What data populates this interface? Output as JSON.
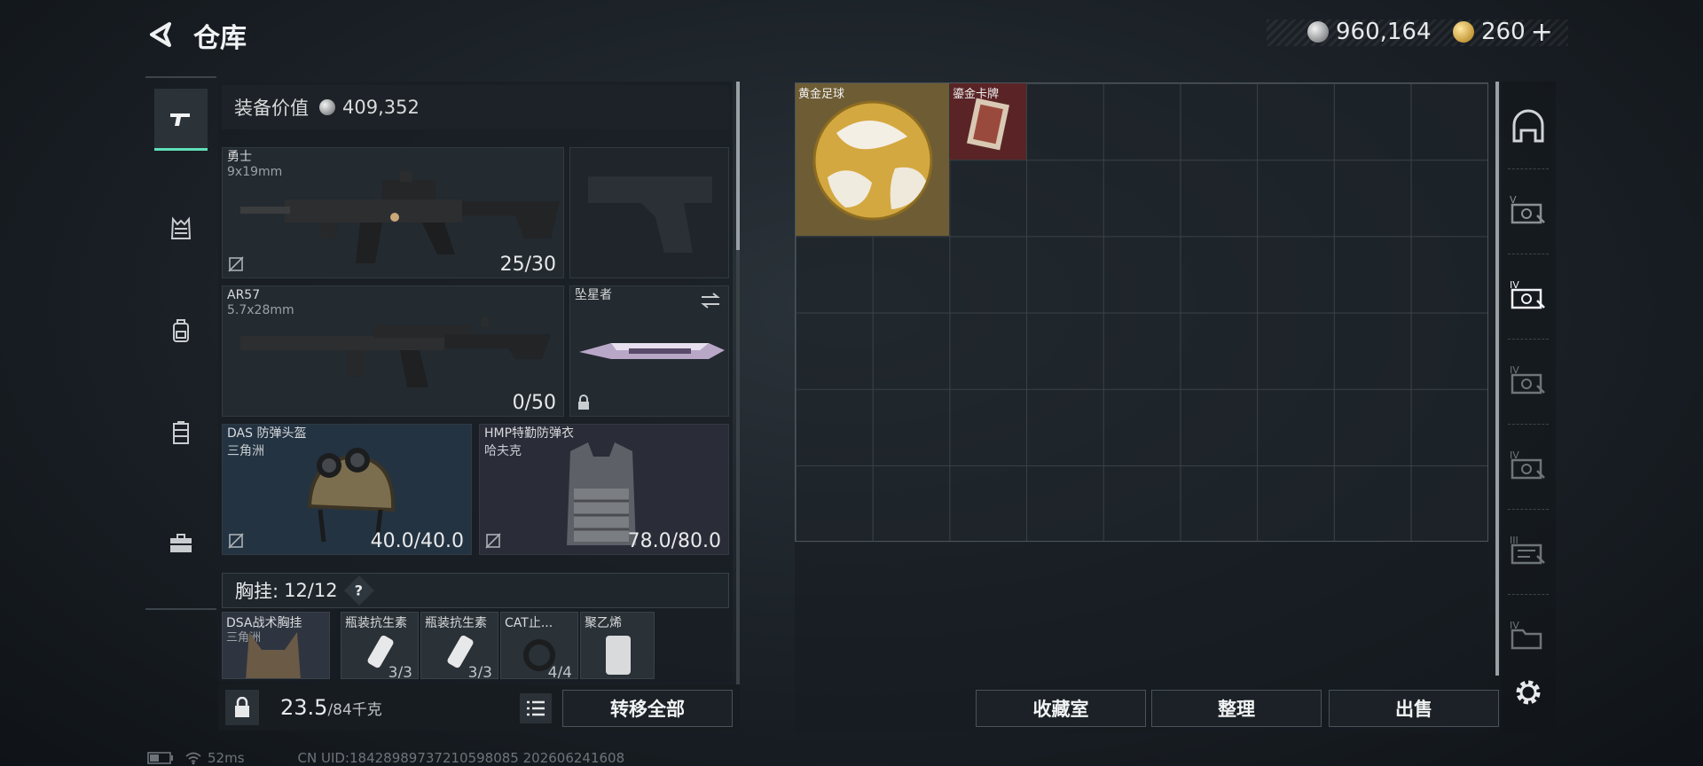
{
  "header": {
    "title": "仓库",
    "silver_amount": "960,164",
    "gold_amount": "260",
    "plus": "+"
  },
  "left_tabs": [
    "gun-icon",
    "chest-rig-icon",
    "backpack-icon",
    "container-icon",
    "briefcase-icon"
  ],
  "equipment": {
    "value_label": "装备价值",
    "value": "409,352",
    "primary": {
      "name": "勇士",
      "caliber": "9x19mm",
      "ammo": "25/30"
    },
    "secondary": {
      "name": "AR57",
      "caliber": "5.7x28mm",
      "ammo": "0/50"
    },
    "melee": {
      "name": "坠星者"
    },
    "helmet": {
      "name": "DAS 防弹头盔",
      "brand": "三角洲",
      "durability": "40.0/40.0"
    },
    "armor": {
      "name": "HMP特勤防弹衣",
      "brand": "哈夫克",
      "durability": "78.0/80.0"
    },
    "chest_label": "胸挂:",
    "chest_capacity": "12/12",
    "chest_help": "?",
    "chest_items": [
      {
        "name": "DSA战术胸挂",
        "sub": "三角洲",
        "count": ""
      },
      {
        "name": "瓶装抗生素",
        "sub": "",
        "count": "3/3"
      },
      {
        "name": "瓶装抗生素",
        "sub": "",
        "count": "3/3"
      },
      {
        "name": "CAT止...",
        "sub": "",
        "count": "4/4"
      },
      {
        "name": "聚乙烯",
        "sub": "",
        "count": ""
      }
    ]
  },
  "bottom": {
    "weight": "23.5",
    "weight_max": "/84千克",
    "transfer_all": "转移全部",
    "collection_room": "收藏室",
    "organize": "整理",
    "sell": "出售"
  },
  "storage_items": [
    {
      "name": "黄金足球"
    },
    {
      "name": "鎏金卡牌"
    }
  ],
  "right_tabs": [
    {
      "icon": "helmet-tab-icon",
      "tier": ""
    },
    {
      "icon": "storage-v-icon",
      "tier": "V"
    },
    {
      "icon": "storage-iv-icon",
      "tier": "IV"
    },
    {
      "icon": "storage-iv-icon",
      "tier": "IV"
    },
    {
      "icon": "storage-iv-icon",
      "tier": "IV"
    },
    {
      "icon": "storage-iii-icon",
      "tier": "III"
    },
    {
      "icon": "storage-iv-icon",
      "tier": "IV"
    }
  ],
  "status_bar": {
    "ping": "52ms",
    "uid": "CN UID:18428989737210598085 202606241608"
  }
}
